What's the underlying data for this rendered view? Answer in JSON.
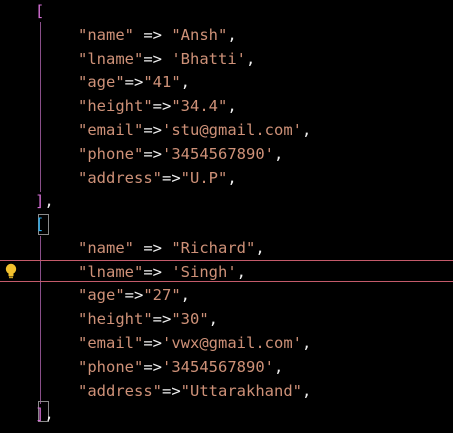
{
  "colors": {
    "background": "#000000",
    "string": "#ce9178",
    "operator": "#f0f0f0",
    "bracket_outer": "#d670d6",
    "bracket_inner": "#2eb0f0",
    "current_line_border": "#c45a6a",
    "lightbulb": "#f2c12e"
  },
  "records": [
    {
      "open": "[",
      "lines": [
        {
          "key": "\"name\"",
          "sep": " => ",
          "value": "\"Ansh\"",
          "end": ","
        },
        {
          "key": "\"lname\"",
          "sep": "=> ",
          "value": "'Bhatti'",
          "end": ","
        },
        {
          "key": "\"age\"",
          "sep": "=>",
          "value": "\"41\"",
          "end": ","
        },
        {
          "key": "\"height\"",
          "sep": "=>",
          "value": "\"34.4\"",
          "end": ","
        },
        {
          "key": "\"email\"",
          "sep": "=>",
          "value": "'stu@gmail.com'",
          "end": ","
        },
        {
          "key": "\"phone\"",
          "sep": "=>",
          "value": "'3454567890'",
          "end": ","
        },
        {
          "key": "\"address\"",
          "sep": "=>",
          "value": "\"U.P\"",
          "end": ","
        }
      ],
      "close": "]",
      "close_end": ","
    },
    {
      "open": "[",
      "lines": [
        {
          "key": "\"name\"",
          "sep": " => ",
          "value": "\"Richard\"",
          "end": ","
        },
        {
          "key": "\"lname\"",
          "sep": "=> ",
          "value": "'Singh'",
          "end": ","
        },
        {
          "key": "\"age\"",
          "sep": "=>",
          "value": "\"27\"",
          "end": ","
        },
        {
          "key": "\"height\"",
          "sep": "=>",
          "value": "\"30\"",
          "end": ","
        },
        {
          "key": "\"email\"",
          "sep": "=>",
          "value": "'vwx@gmail.com'",
          "end": ","
        },
        {
          "key": "\"phone\"",
          "sep": "=>",
          "value": "'3454567890'",
          "end": ","
        },
        {
          "key": "\"address\"",
          "sep": "=>",
          "value": "\"Uttarakhand\"",
          "end": ","
        }
      ],
      "close": "]",
      "close_end": ","
    }
  ],
  "gutter_icon": "lightbulb-icon"
}
